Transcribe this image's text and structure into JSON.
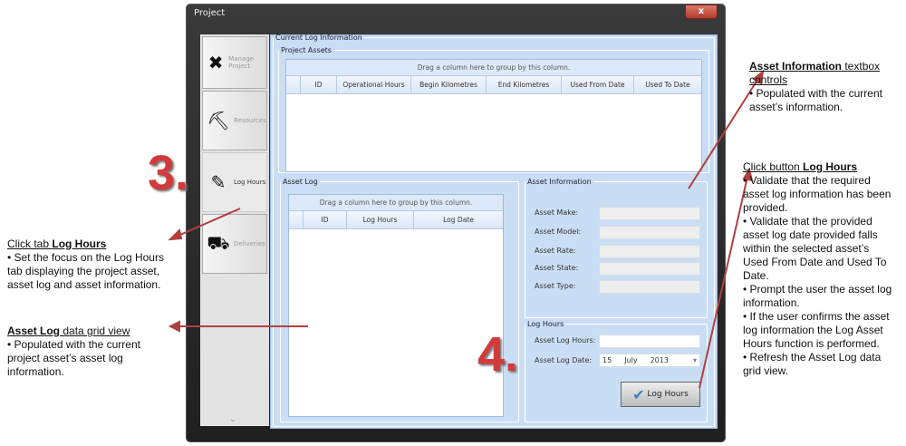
{
  "window": {
    "title": "Project",
    "close": "x"
  },
  "sidebar": {
    "tabs": [
      {
        "label": "Manage Project",
        "icon": "tools-icon"
      },
      {
        "label": "Resources",
        "icon": "excavator-icon"
      },
      {
        "label": "Log Hours",
        "icon": "pencil-icon"
      },
      {
        "label": "Deliveries",
        "icon": "truck-icon"
      }
    ],
    "more": "⌄"
  },
  "main": {
    "title": "Current Log Information",
    "project_assets": {
      "title": "Project Assets",
      "group_hint": "Drag a column here to group by this column.",
      "columns": [
        "ID",
        "Operational Hours",
        "Begin Kilometres",
        "End Kilometres",
        "Used From Date",
        "Used To Date"
      ]
    },
    "asset_log": {
      "title": "Asset Log",
      "group_hint": "Drag a column here to group by this column.",
      "columns": [
        "ID",
        "Log Hours",
        "Log Date"
      ]
    },
    "asset_info": {
      "title": "Asset Information",
      "fields": [
        "Asset Make:",
        "Asset Model:",
        "Asset Rate:",
        "Asset State:",
        "Asset Type:"
      ]
    },
    "log_hours": {
      "title": "Log Hours",
      "hours_label": "Asset Log Hours:",
      "date_label": "Asset Log Date:",
      "day": "15",
      "month": "July",
      "year": "2013",
      "button": "Log Hours"
    }
  },
  "callouts": {
    "n3": "3.",
    "n4": "4.",
    "tab": {
      "pre": "Click tab ",
      "bold": "Log Hours",
      "body": "• Set the focus on the Log Hours tab displaying the project asset, asset log and asset information."
    },
    "grid": {
      "bold": "Asset Log",
      "rest": "  data grid view",
      "body": "• Populated with the current project asset’s asset log information."
    },
    "info": {
      "bold": "Asset Information",
      "rest": " textbox controls",
      "body": "• Populated with the current asset’s information."
    },
    "button": {
      "pre": "Click button ",
      "bold": "Log Hours",
      "items": [
        "• Validate that the required asset log information has been provided.",
        "• Validate that the provided asset log date provided falls within the selected asset’s Used From Date and Used To Date.",
        "• Prompt the user the asset log information.",
        "• If the user confirms the asset log information the Log Asset Hours function is performed.",
        "• Refresh the Asset Log data grid view."
      ]
    }
  }
}
